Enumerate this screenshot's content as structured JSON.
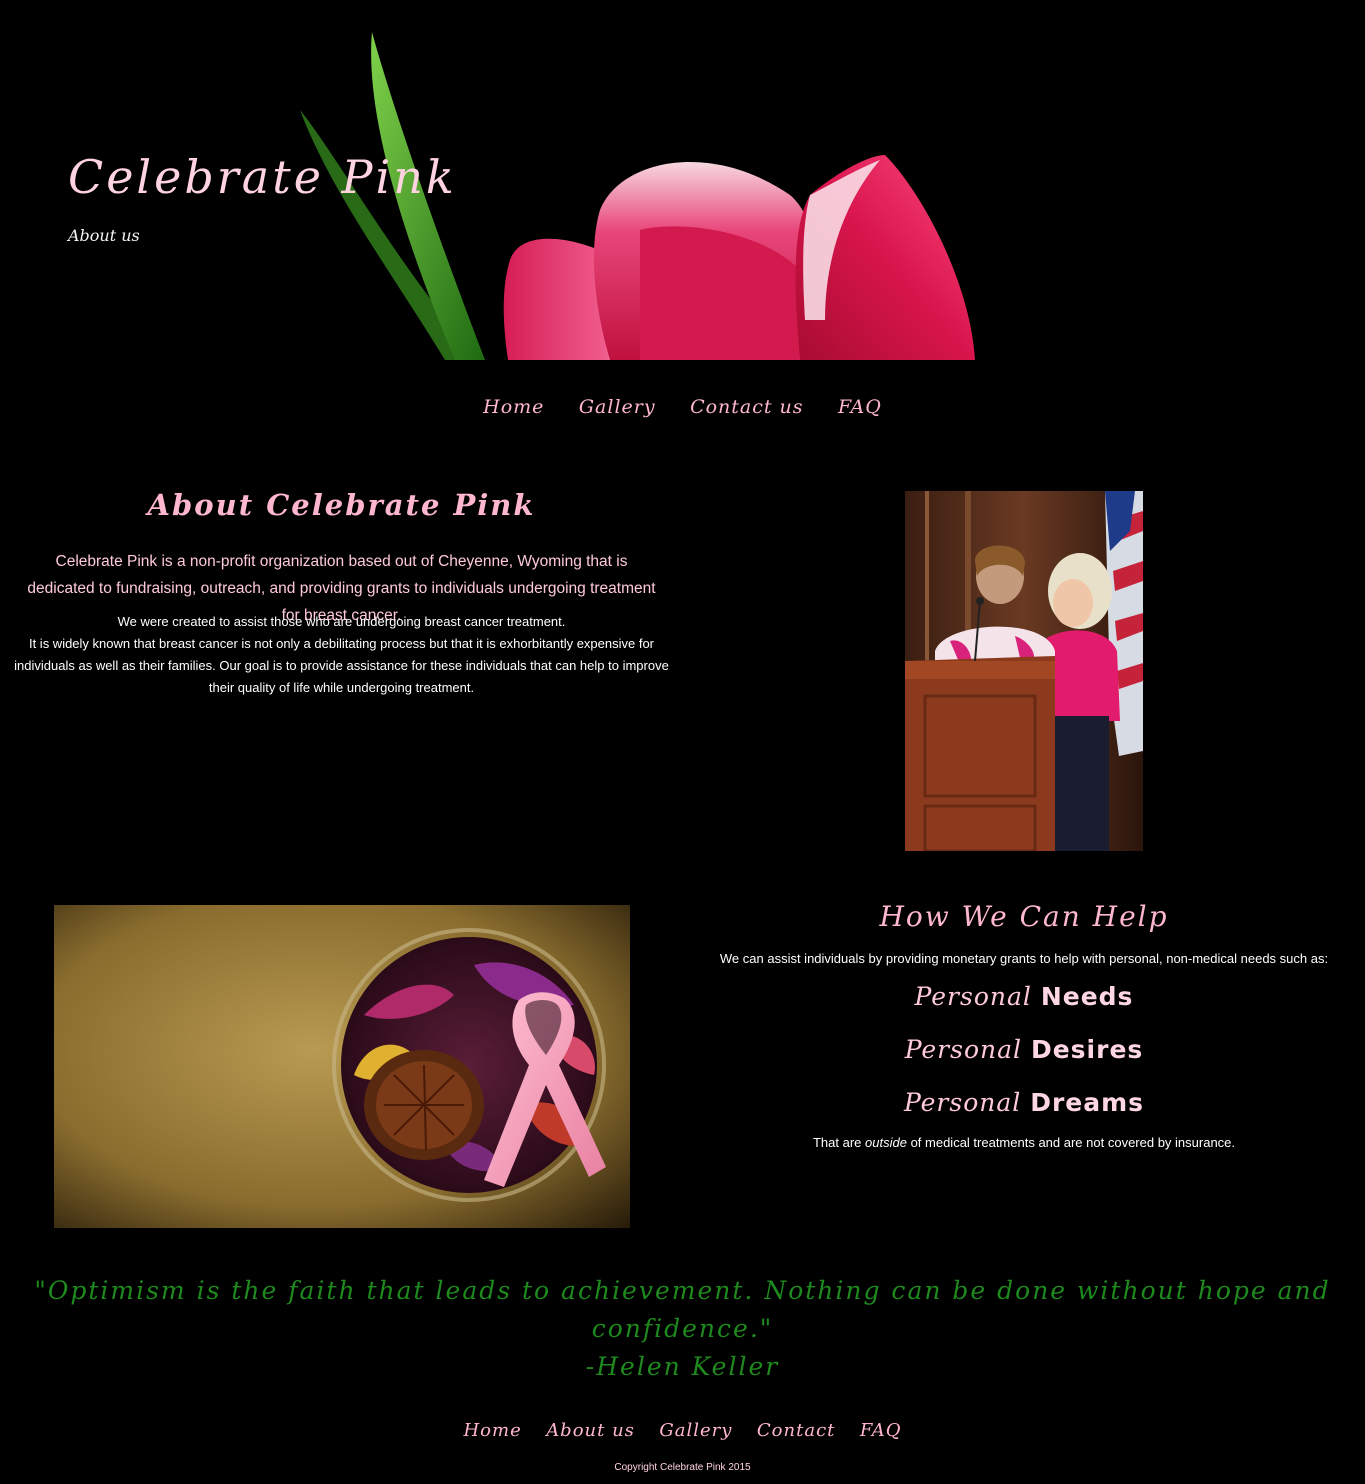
{
  "header": {
    "title": "Celebrate Pink",
    "subtitle": "About us"
  },
  "nav": [
    {
      "label": "Home"
    },
    {
      "label": "Gallery"
    },
    {
      "label": "Contact us"
    },
    {
      "label": "FAQ"
    }
  ],
  "about": {
    "title": "About Celebrate Pink",
    "lead": "Celebrate Pink is a non-profit organization based out of Cheyenne, Wyoming that is dedicated to fundraising, outreach, and providing grants to individuals undergoing treatment for breast cancer.",
    "body_line1": "We were created to assist those who are undergoing breast cancer treatment.",
    "body_line2": "It is widely known that breast cancer is not only a debilitating process but that it is exhorbitantly expensive for individuals as well as their families. Our goal is to provide assistance for these individuals that can help to improve their quality of life while undergoing treatment."
  },
  "help": {
    "title": "How We Can Help",
    "intro": "We can assist individuals by providing monetary grants to help with personal, non-medical needs such as:",
    "items": [
      {
        "prefix": "Personal",
        "word": "Needs"
      },
      {
        "prefix": "Personal",
        "word": "Desires"
      },
      {
        "prefix": "Personal",
        "word": "Dreams"
      }
    ],
    "note_before": "That are",
    "note_em": "outside",
    "note_after": "of medical treatments and are not covered by insurance."
  },
  "quote": {
    "text": "\"Optimism is the faith that leads to achievement. Nothing can be done without hope and confidence.\"",
    "author": "-Helen Keller"
  },
  "footer": {
    "nav": [
      {
        "label": "Home"
      },
      {
        "label": "About us"
      },
      {
        "label": "Gallery"
      },
      {
        "label": "Contact"
      },
      {
        "label": "FAQ"
      }
    ],
    "copyright": "Copyright Celebrate Pink 2015"
  },
  "colors": {
    "background": "#000000",
    "accent_pink": "#ffb6cf",
    "quote_green": "#1e8a1e"
  }
}
